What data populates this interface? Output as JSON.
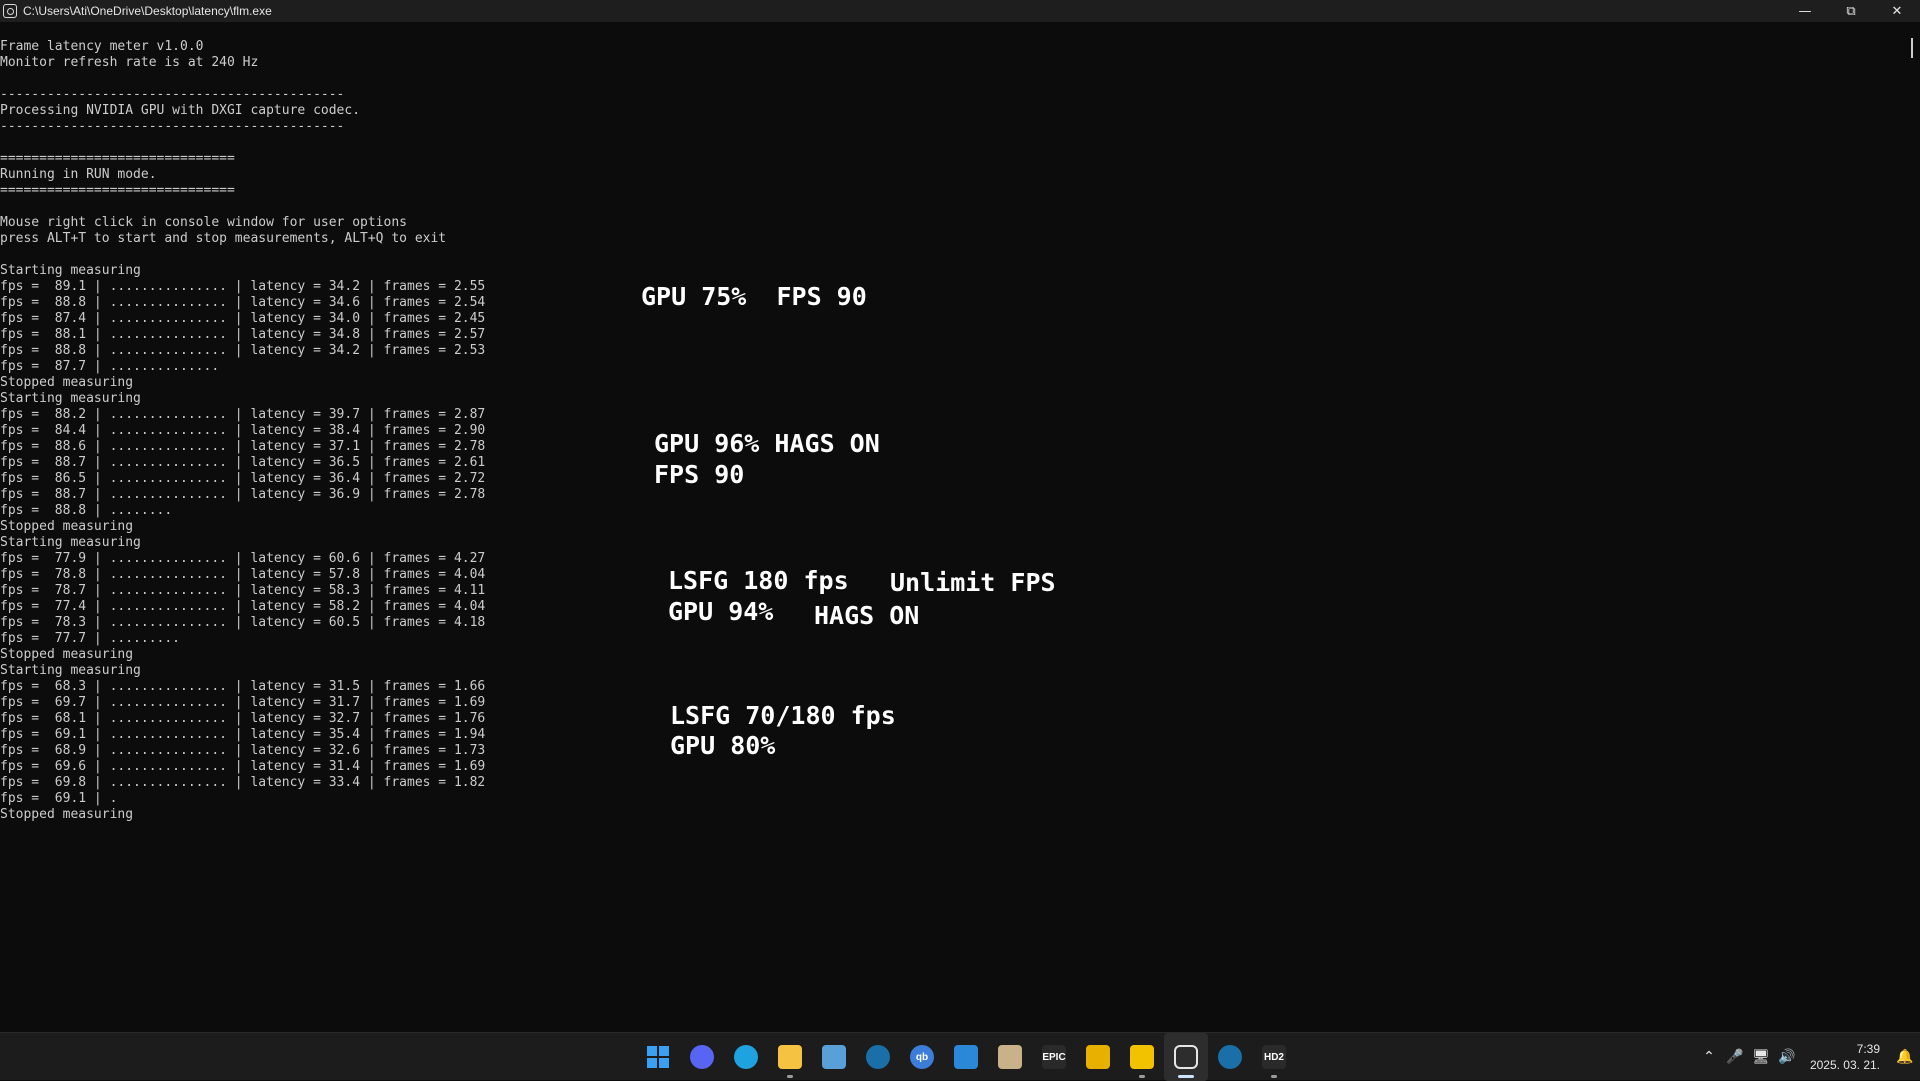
{
  "window": {
    "title": "C:\\Users\\Ati\\OneDrive\\Desktop\\latency\\flm.exe",
    "minimize_icon": "minimize-icon",
    "restore_icon": "restore-icon",
    "close_icon": "close-icon"
  },
  "console_lines": [
    "Frame latency meter v1.0.0",
    "Monitor refresh rate is at 240 Hz",
    "",
    "--------------------------------------------",
    "Processing NVIDIA GPU with DXGI capture codec.",
    "--------------------------------------------",
    "",
    "==============================",
    "Running in RUN mode.",
    "==============================",
    "",
    "Mouse right click in console window for user options",
    "press ALT+T to start and stop measurements, ALT+Q to exit",
    "",
    "Starting measuring",
    "fps =  89.1 | ............... | latency = 34.2 | frames = 2.55",
    "fps =  88.8 | ............... | latency = 34.6 | frames = 2.54",
    "fps =  87.4 | ............... | latency = 34.0 | frames = 2.45",
    "fps =  88.1 | ............... | latency = 34.8 | frames = 2.57",
    "fps =  88.8 | ............... | latency = 34.2 | frames = 2.53",
    "fps =  87.7 | ..............",
    "Stopped measuring",
    "Starting measuring",
    "fps =  88.2 | ............... | latency = 39.7 | frames = 2.87",
    "fps =  84.4 | ............... | latency = 38.4 | frames = 2.90",
    "fps =  88.6 | ............... | latency = 37.1 | frames = 2.78",
    "fps =  88.7 | ............... | latency = 36.5 | frames = 2.61",
    "fps =  86.5 | ............... | latency = 36.4 | frames = 2.72",
    "fps =  88.7 | ............... | latency = 36.9 | frames = 2.78",
    "fps =  88.8 | ........",
    "Stopped measuring",
    "Starting measuring",
    "fps =  77.9 | ............... | latency = 60.6 | frames = 4.27",
    "fps =  78.8 | ............... | latency = 57.8 | frames = 4.04",
    "fps =  78.7 | ............... | latency = 58.3 | frames = 4.11",
    "fps =  77.4 | ............... | latency = 58.2 | frames = 4.04",
    "fps =  78.3 | ............... | latency = 60.5 | frames = 4.18",
    "fps =  77.7 | .........",
    "Stopped measuring",
    "Starting measuring",
    "fps =  68.3 | ............... | latency = 31.5 | frames = 1.66",
    "fps =  69.7 | ............... | latency = 31.7 | frames = 1.69",
    "fps =  68.1 | ............... | latency = 32.7 | frames = 1.76",
    "fps =  69.1 | ............... | latency = 35.4 | frames = 1.94",
    "fps =  68.9 | ............... | latency = 32.6 | frames = 1.73",
    "fps =  69.6 | ............... | latency = 31.4 | frames = 1.69",
    "fps =  69.8 | ............... | latency = 33.4 | frames = 1.82",
    "fps =  69.1 | .",
    "Stopped measuring"
  ],
  "annotations": {
    "note1": "GPU 75%  FPS 90",
    "note2a": "GPU 96% HAGS ON",
    "note2b": "FPS 90",
    "note3a": "LSFG 180 fps",
    "note3b": "Unlimit FPS",
    "note3c": "GPU 94%",
    "note3d": "HAGS ON",
    "note4a": "LSFG 70/180 fps",
    "note4b": "GPU 80%"
  },
  "taskbar": {
    "apps": [
      {
        "name": "start-button",
        "icon": "windows-icon",
        "color": "#3aa0f3",
        "label": ""
      },
      {
        "name": "discord",
        "icon": "discord-icon",
        "color": "#5865f2",
        "label": ""
      },
      {
        "name": "edge",
        "icon": "edge-icon",
        "color": "#1fa3e0",
        "label": ""
      },
      {
        "name": "file-explorer",
        "icon": "folder-icon",
        "color": "#f5c242",
        "label": ""
      },
      {
        "name": "photos",
        "icon": "photos-icon",
        "color": "#5aa0d8",
        "label": ""
      },
      {
        "name": "steam",
        "icon": "steam-icon",
        "color": "#1b6fa8",
        "label": ""
      },
      {
        "name": "qbittorrent",
        "icon": "qbittorrent-icon",
        "color": "#3b7dd8",
        "label": "qb"
      },
      {
        "name": "store",
        "icon": "store-icon",
        "color": "#2b88d8",
        "label": ""
      },
      {
        "name": "notes",
        "icon": "notepad-icon",
        "color": "#c9b28a",
        "label": ""
      },
      {
        "name": "epic-games",
        "icon": "epic-games-icon",
        "color": "#2a2a2a",
        "label": "EPIC"
      },
      {
        "name": "stats",
        "icon": "bar-chart-icon",
        "color": "#e8b000",
        "label": ""
      },
      {
        "name": "lossless-scaling",
        "icon": "duck-icon",
        "color": "#f2c200",
        "label": ""
      },
      {
        "name": "flm",
        "icon": "flm-icon",
        "color": "#e6e6e6",
        "label": ""
      },
      {
        "name": "steam-2",
        "icon": "steam-icon",
        "color": "#1b6fa8",
        "label": ""
      },
      {
        "name": "hd2",
        "icon": "hd2-icon",
        "color": "#2a2a2a",
        "label": "HD2"
      }
    ],
    "clock_time": "7:39",
    "clock_date": "2025. 03. 21."
  }
}
